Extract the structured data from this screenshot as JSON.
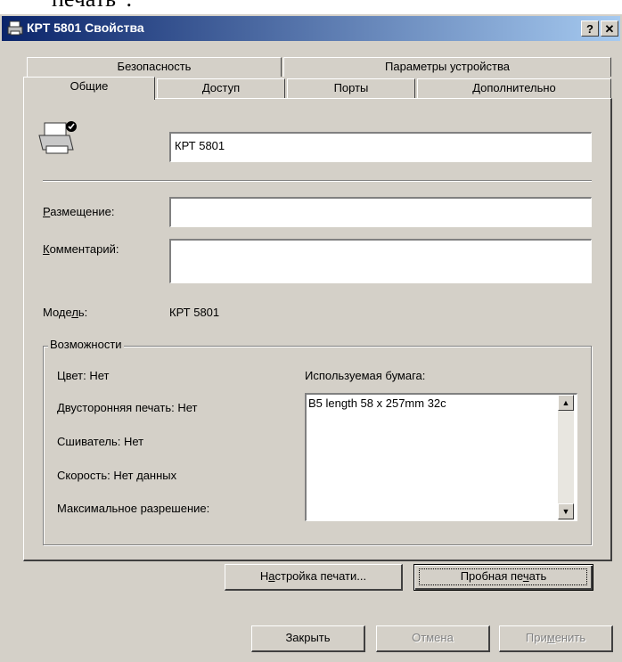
{
  "background_text": "печать”.",
  "window": {
    "title": "КРТ 5801 Свойства",
    "help_button": "?",
    "close_button": "✕"
  },
  "tabs": {
    "row1": [
      "Безопасность",
      "Параметры устройства"
    ],
    "row2": [
      "Общие",
      "Доступ",
      "Порты",
      "Дополнительно"
    ],
    "active": "Общие"
  },
  "general": {
    "printer_name": "КРТ 5801",
    "location_label_ul": "Р",
    "location_label_rest": "азмещение:",
    "location_value": "",
    "comment_label_ul": "К",
    "comment_label_rest": "омментарий:",
    "comment_value": "",
    "model_label_pre": "Моде",
    "model_label_ul": "л",
    "model_label_post": "ь:",
    "model_value": "КРТ 5801"
  },
  "features": {
    "title": "Возможности",
    "color": "Цвет: Нет",
    "duplex": "Двусторонняя печать: Нет",
    "stapler": "Сшиватель: Нет",
    "speed": "Скорость: Нет данных",
    "max_resolution": "Максимальное разрешение:",
    "paper_label": "Используемая бумага:",
    "paper_items": [
      "B5 length 58 x 257mm 32c"
    ]
  },
  "buttons": {
    "print_settings_pre": "Н",
    "print_settings_ul": "а",
    "print_settings_post": "стройка печати...",
    "test_print_pre": "Пробная пе",
    "test_print_ul": "ч",
    "test_print_post": "ать",
    "close": "Закрыть",
    "cancel": "Отмена",
    "apply_pre": "При",
    "apply_ul": "м",
    "apply_post": "енить"
  }
}
